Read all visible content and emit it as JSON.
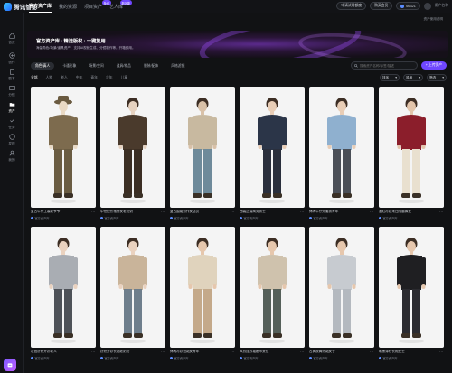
{
  "app": {
    "name": "腾讯智影"
  },
  "top_tabs": [
    {
      "label": "官方资产库",
      "active": true,
      "badge": ""
    },
    {
      "label": "我的资源",
      "active": false,
      "badge": ""
    },
    {
      "label": "项目资产",
      "active": false,
      "badge": "免费"
    },
    {
      "label": "艺人库",
      "active": false,
      "badge": "新功能"
    }
  ],
  "top_right": {
    "btn1": "申请试用额度",
    "btn2": "购买会员",
    "credits": "66321",
    "user": "用户名称"
  },
  "rail": [
    {
      "label": "首页",
      "icon": "home-icon"
    },
    {
      "label": "创作",
      "icon": "create-icon"
    },
    {
      "label": "剧本",
      "icon": "script-icon"
    },
    {
      "label": "分镜",
      "icon": "storyboard-icon"
    },
    {
      "label": "资产",
      "icon": "asset-icon",
      "active": true
    },
    {
      "label": "任务",
      "icon": "task-icon"
    },
    {
      "label": "发现",
      "icon": "discover-icon"
    },
    {
      "label": "我的",
      "icon": "user-icon"
    }
  ],
  "banner": {
    "title": "官方资产库 · 精选版权 · 一键复用",
    "subtitle": "海量角色/场景/道具资产，支持AI视频生成、分镜制作等，开箱即用。",
    "link": "资产使用说明"
  },
  "categories": [
    "角色/真人",
    "卡通形象",
    "场景/空间",
    "道具/物品",
    "服装/配饰",
    "风格滤镜"
  ],
  "search": {
    "placeholder": "搜索资产名称/标签/描述"
  },
  "upload_label": "+ 上传资产",
  "filters": [
    "全部",
    "人物",
    "老人",
    "中年",
    "青年",
    "少年",
    "儿童"
  ],
  "selects": [
    {
      "label": "排序"
    },
    {
      "label": "风格"
    },
    {
      "label": "筛选"
    }
  ],
  "cards": [
    {
      "title": "复古牛仔工装老爷爷",
      "source": "官方资产库"
    },
    {
      "title": "中世纪长袍修女老奶奶",
      "source": "官方资产库"
    },
    {
      "title": "复古围裙劳作女店员",
      "source": "官方资产库"
    },
    {
      "title": "西装正装商务男士",
      "source": "官方资产库"
    },
    {
      "title": "休闲牛仔外套男青年",
      "source": "官方资产库"
    },
    {
      "title": "酒红衬衫米白阔腿裤女",
      "source": "官方资产库"
    },
    {
      "title": "灰色针织开衫老人",
      "source": "官方资产库"
    },
    {
      "title": "针织开衫长裙老奶奶",
      "source": "官方资产库"
    },
    {
      "title": "休闲衬衫短裙女青年",
      "source": "官方资产库"
    },
    {
      "title": "风衣连衣裙都市女性",
      "source": "官方资产库"
    },
    {
      "title": "古典披肩纱裙女子",
      "source": "官方资产库"
    },
    {
      "title": "暗黑薄纱长袍女士",
      "source": "官方资产库"
    }
  ],
  "colors": {
    "accent": "#6f47ff",
    "bg": "#111214"
  }
}
